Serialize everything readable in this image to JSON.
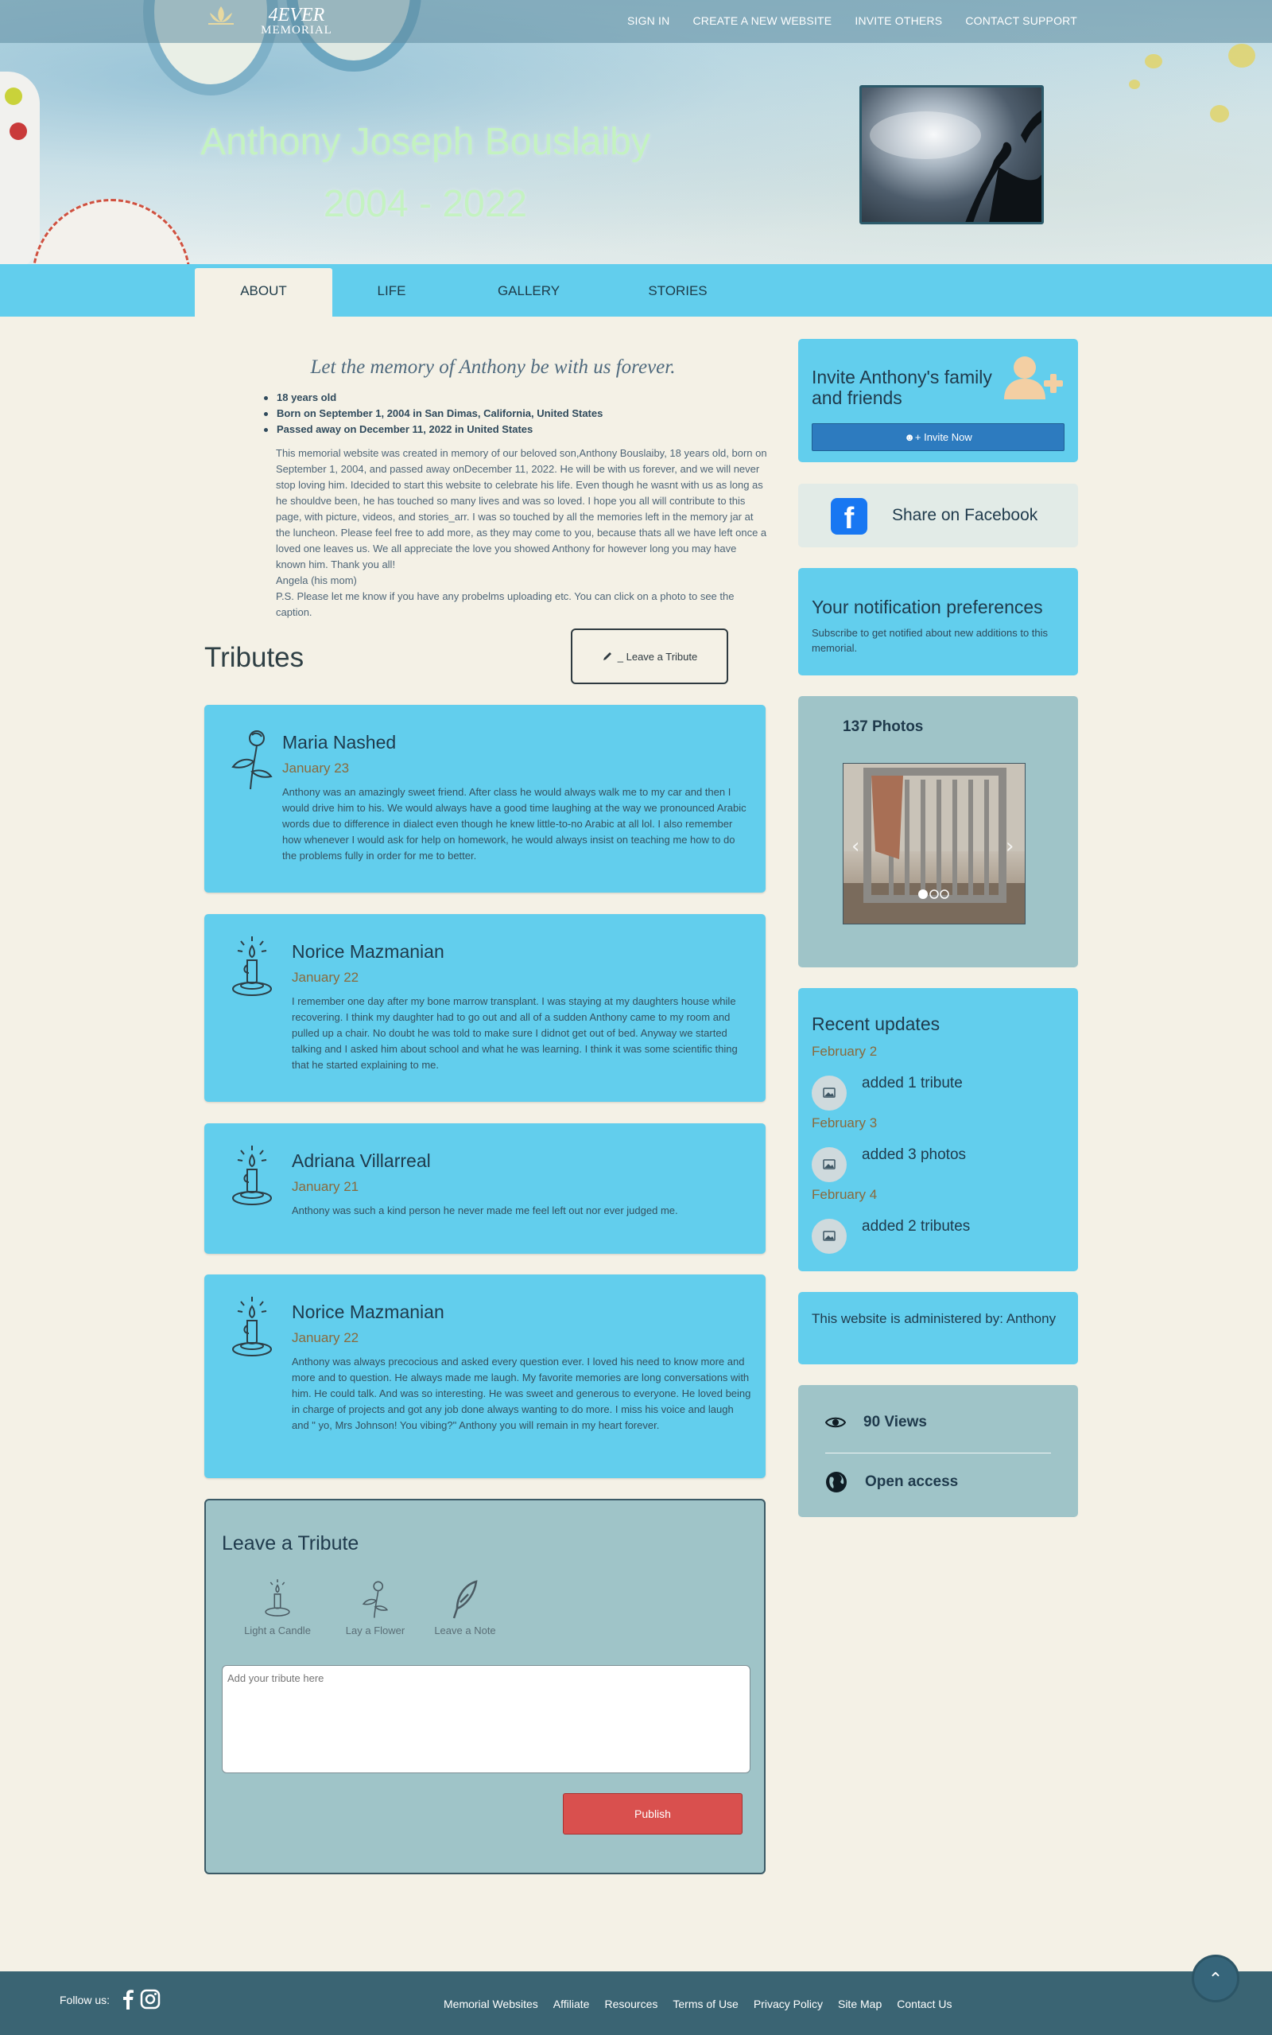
{
  "header": {
    "logo_line1": "4EVER",
    "logo_line2": "MEMORIAL",
    "nav": [
      "SIGN IN",
      "CREATE A NEW WEBSITE",
      "INVITE OTHERS",
      "CONTACT SUPPORT"
    ]
  },
  "hero": {
    "name": "Anthony Joseph Bouslaiby",
    "years": "2004 - 2022"
  },
  "tabs": [
    "ABOUT",
    "LIFE",
    "GALLERY",
    "STORIES"
  ],
  "about": {
    "motto": "Let the memory of Anthony be with us forever.",
    "facts": [
      "18 years old",
      "Born on September 1, 2004 in San Dimas, California, United States",
      "Passed away on December 11, 2022 in United States"
    ],
    "bio": "This memorial website was created in memory of our beloved son,Anthony Bouslaiby, 18 years old, born on September 1, 2004, and passed away onDecember 11, 2022. He will be with us forever, and we will never stop loving him. Idecided to start this website to celebrate his life. Even though he wasnt with us as long as he shouldve been, he has touched so many lives and was so loved. I hope you all will contribute to this page, with picture, videos, and stories_arr. I was so touched by all the memories left in the memory jar at the luncheon. Please feel free to add more, as they may come to you, because thats all we have left once a loved one leaves us. We all appreciate the love you showed Anthony for however long you may have known him. Thank you all!",
    "signature": "Angela (his mom)",
    "ps": "P.S. Please let me know if you have any probelms uploading etc. You can click on a photo to see the caption."
  },
  "tributes": {
    "heading": "Tributes",
    "leave_button": "_ Leave a Tribute",
    "items": [
      {
        "name": "Maria Nashed",
        "date": "January 23",
        "icon": "flower-icon",
        "text": "Anthony was an amazingly sweet friend. After class he would always walk me to my car and then I would drive him to his. We would always have a good time laughing at the way we pronounced Arabic words due to difference in dialect even though he knew little-to-no Arabic at all lol. I also remember how whenever I would ask for help on homework, he would always insist on teaching me how to do the problems fully in order for me to better."
      },
      {
        "name": "Norice Mazmanian",
        "date": "January 22",
        "icon": "candle-icon",
        "text": "I remember one day after my bone marrow transplant. I was staying at my daughters house while recovering. I think my daughter had to go out and all of a sudden Anthony came to my room and pulled up a chair. No doubt he was told to make sure I didnot get out of bed. Anyway we started talking and I asked him about school and what he was learning. I think it was some scientific thing that he started explaining to me."
      },
      {
        "name": "Adriana Villarreal",
        "date": "January 21",
        "icon": "candle-icon",
        "text": "Anthony was such a kind person he never made me feel left out nor ever judged me."
      },
      {
        "name": "Norice Mazmanian",
        "date": "January 22",
        "icon": "candle-icon",
        "text": "Anthony was always precocious and asked every question ever. I loved his need to know more and more and to question. He always made me laugh. My favorite memories are long conversations with him. He could talk. And was so interesting. He was sweet and generous to everyone. He loved being in charge of projects and got any job done always wanting to do more. I miss his voice and laugh and \" yo, Mrs Johnson! You vibing?\" Anthony you will remain in my heart forever."
      }
    ]
  },
  "compose": {
    "heading": "Leave a Tribute",
    "options": [
      "Light a Candle",
      "Lay a Flower",
      "Leave a Note"
    ],
    "placeholder": "Add your tribute here",
    "publish": "Publish"
  },
  "sidebar": {
    "invite_heading": "Invite Anthony's family and friends",
    "invite_button": "Invite Now",
    "facebook_label": "Share on Facebook",
    "notif_heading": "Your notification preferences",
    "notif_text": "Subscribe to get notified about new additions to this memorial.",
    "photos_count": "137 Photos",
    "carousel": {
      "slides": 3,
      "active_index": 0
    },
    "updates_heading": "Recent updates",
    "updates": [
      {
        "date": "February 2",
        "text": "added 1 tribute"
      },
      {
        "date": "February 3",
        "text": "added 3 photos"
      },
      {
        "date": "February 4",
        "text": "added 2 tributes"
      }
    ],
    "admin_text": "This website is administered by: Anthony",
    "views": "90 Views",
    "access": "Open access"
  },
  "footer": {
    "follow": "Follow us:",
    "links": [
      "Memorial Websites",
      "Affiliate",
      "Resources",
      "Terms of Use",
      "Privacy Policy",
      "Site Map",
      "Contact Us"
    ]
  },
  "colors": {
    "accent_blue": "#62ceed",
    "teal_panel": "#9fc4c8",
    "page_bg": "#f4f1e6",
    "publish_red": "#d9504e",
    "footer_bg": "#3a6473"
  }
}
